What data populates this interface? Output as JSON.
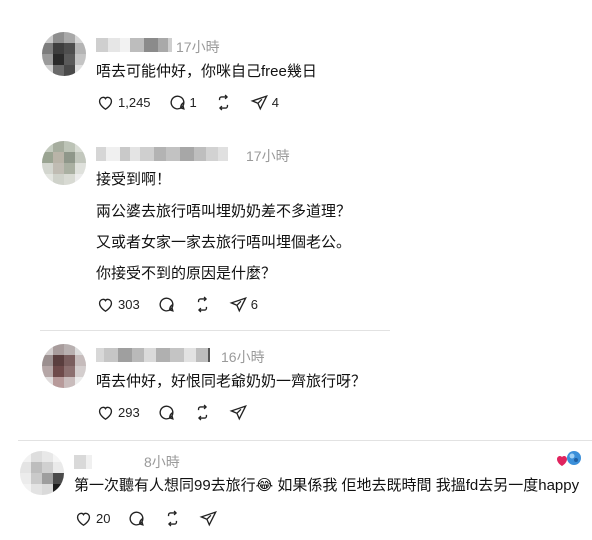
{
  "comments": [
    {
      "time": "17小時",
      "lines": [
        "唔去可能仲好，你咪自己free幾日"
      ],
      "likes": "1,245",
      "replies": "1",
      "shares": "4"
    },
    {
      "time": "17小時",
      "lines": [
        "接受到啊！",
        "兩公婆去旅行唔叫埋奶奶差不多道理？",
        "又或者女家一家去旅行唔叫埋個老公。",
        "你接受不到的原因是什麼？"
      ],
      "likes": "303",
      "replies": "",
      "shares": "6"
    },
    {
      "time": "16小時",
      "lines": [
        "唔去仲好，好恨同老爺奶奶一齊旅行呀？"
      ],
      "likes": "293",
      "replies": "",
      "shares": ""
    },
    {
      "time": "8小時",
      "lines": [
        "第一次聽有人想同99去旅行😂 如果係我 佢地去既時間 我搵fd去另一度happy"
      ],
      "likes": "20",
      "replies": "",
      "shares": ""
    }
  ],
  "icons": [
    "heart-icon",
    "comment-icon",
    "repost-icon",
    "share-icon"
  ]
}
